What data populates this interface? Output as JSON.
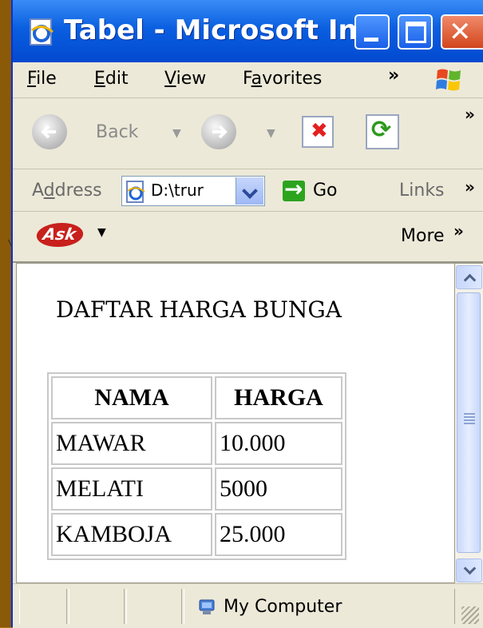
{
  "window": {
    "title": "Tabel - Microsoft In..."
  },
  "menu": {
    "items": [
      {
        "label": "File",
        "accel": "F",
        "rest": "ile"
      },
      {
        "label": "Edit",
        "accel": "E",
        "rest": "dit"
      },
      {
        "label": "View",
        "accel": "V",
        "rest": "iew"
      },
      {
        "label": "Favorites",
        "pre": "F",
        "accel": "a",
        "rest": "vorites"
      }
    ],
    "overflow": "»"
  },
  "toolbar": {
    "back_label": "Back",
    "overflow": "»"
  },
  "address": {
    "label_pre": "A",
    "label_accel": "d",
    "label_rest": "dress",
    "value": "D:\\trur",
    "go_label": "Go",
    "links_label": "Links",
    "overflow": "»"
  },
  "askbar": {
    "logo": "Ask",
    "more_label": "More",
    "overflow": "»"
  },
  "page": {
    "heading": "DAFTAR HARGA BUNGA",
    "table": {
      "headers": [
        "NAMA",
        "HARGA"
      ],
      "rows": [
        [
          "MAWAR",
          "10.000"
        ],
        [
          "MELATI",
          "5000"
        ],
        [
          "KAMBOJA",
          "25.000"
        ]
      ]
    }
  },
  "status": {
    "zone": "My Computer"
  },
  "icons": [
    "ie-page-icon",
    "minimize-icon",
    "maximize-icon",
    "close-icon",
    "windows-logo-icon",
    "back-arrow-icon",
    "forward-arrow-icon",
    "stop-icon",
    "refresh-icon",
    "go-arrow-icon",
    "computer-icon"
  ]
}
